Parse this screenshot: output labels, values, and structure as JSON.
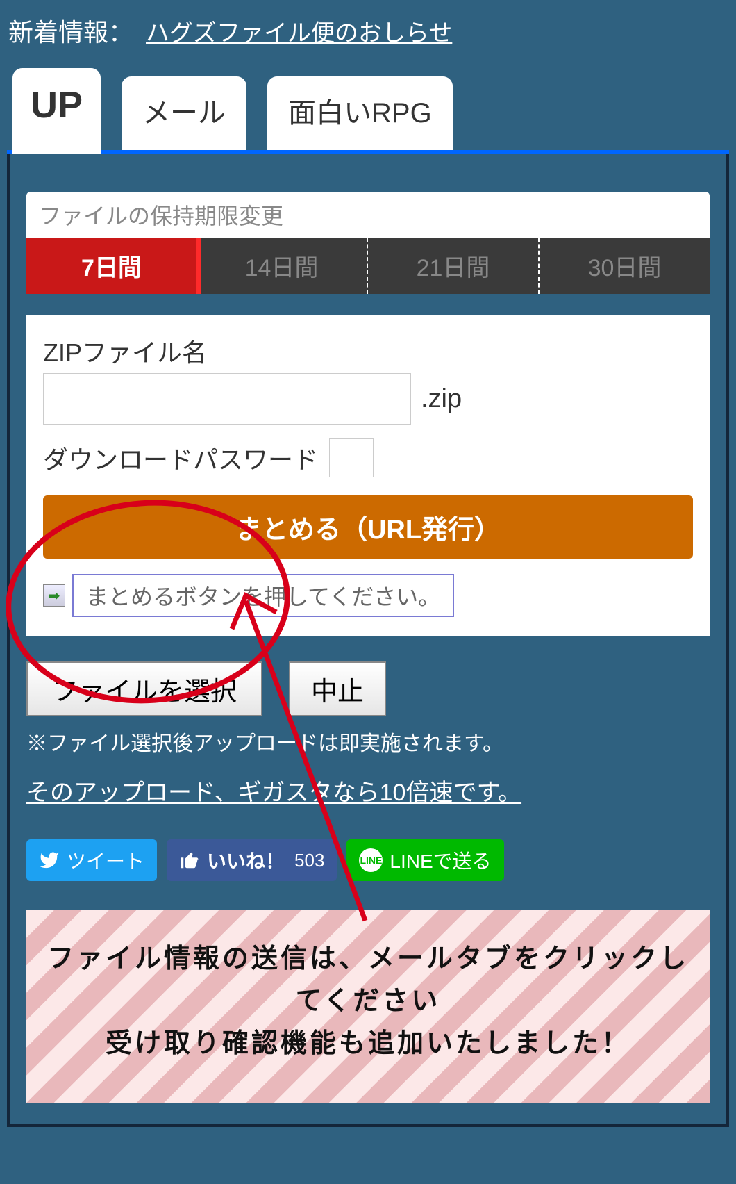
{
  "header": {
    "label": "新着情報：",
    "link": "ハグズファイル便のおしらせ"
  },
  "tabs": [
    {
      "label": "UP",
      "active": true
    },
    {
      "label": "メール",
      "active": false
    },
    {
      "label": "面白いRPG",
      "active": false
    }
  ],
  "retention": {
    "title": "ファイルの保持期限変更",
    "options": [
      "7日間",
      "14日間",
      "21日間",
      "30日間"
    ],
    "active": 0
  },
  "form": {
    "zipLabel": "ZIPファイル名",
    "zipSuffix": ".zip",
    "passwordLabel": "ダウンロードパスワード",
    "submitLabel": "まとめる（URL発行）",
    "hintText": "まとめるボタンを押してください。"
  },
  "actions": {
    "selectFileLabel": "ファイルを選択",
    "cancelLabel": "中止",
    "note": "※ファイル選択後アップロードは即実施されます。",
    "speedLink": "そのアップロード、ギガスタなら10倍速です。"
  },
  "social": {
    "tweet": "ツイート",
    "like": "いいね！",
    "likeCount": "503",
    "lineLabel": "LINEで送る",
    "lineIcon": "LINE"
  },
  "infoBox": {
    "line1": "ファイル情報の送信は、メールタブをクリックしてください",
    "line2": "受け取り確認機能も追加いたしました！"
  }
}
